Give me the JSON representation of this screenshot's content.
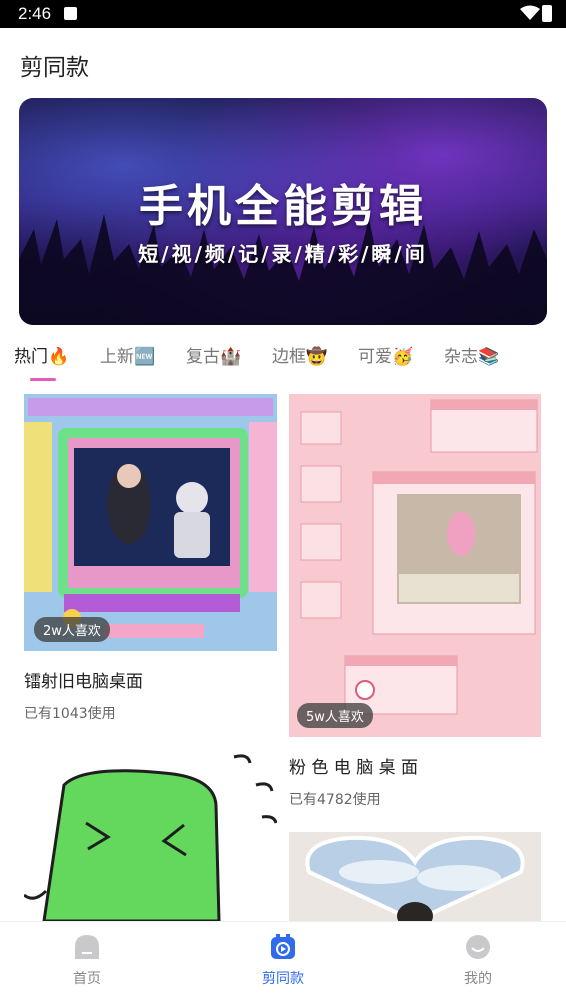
{
  "status_bar": {
    "time": "2:46"
  },
  "page": {
    "title": "剪同款"
  },
  "banner": {
    "headline": "手机全能剪辑",
    "subtitle": "短/视/频/记/录/精/彩/瞬/间"
  },
  "tabs": [
    {
      "label": "热门🔥",
      "active": true
    },
    {
      "label": "上新🆕",
      "active": false
    },
    {
      "label": "复古🏰",
      "active": false
    },
    {
      "label": "边框🤠",
      "active": false
    },
    {
      "label": "可爱🥳",
      "active": false
    },
    {
      "label": "杂志📚",
      "active": false
    }
  ],
  "templates": [
    {
      "title": "镭射旧电脑桌面",
      "usage": "已有1043使用",
      "likes": "2w人喜欢"
    },
    {
      "title": "粉 色 电 脑 桌 面",
      "usage": "已有4782使用",
      "likes": "5w人喜欢"
    }
  ],
  "bottom_nav": [
    {
      "label": "首页",
      "icon": "home-icon",
      "active": false
    },
    {
      "label": "剪同款",
      "icon": "play-icon",
      "active": true
    },
    {
      "label": "我的",
      "icon": "profile-icon",
      "active": false
    }
  ],
  "colors": {
    "accent": "#2f6bea",
    "tab_indicator": "#e35db8"
  }
}
